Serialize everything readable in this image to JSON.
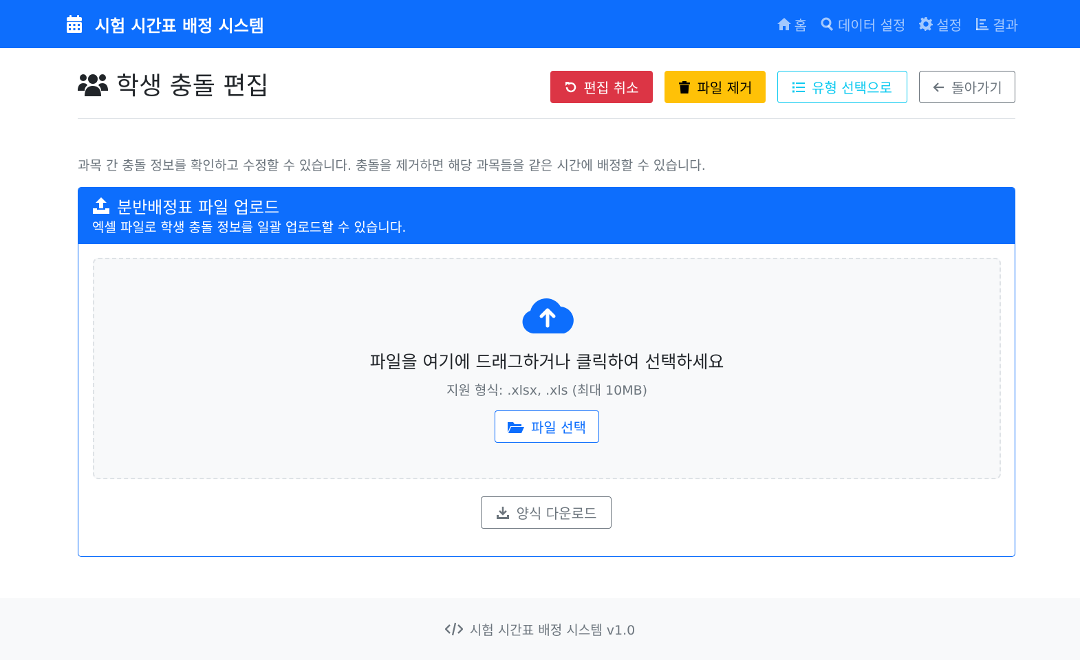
{
  "navbar": {
    "brand": "시험 시간표 배정 시스템",
    "brand_icon": "calendar-icon",
    "links": [
      {
        "label": "홈",
        "icon": "home-icon"
      },
      {
        "label": "데이터 설정",
        "icon": "search-icon"
      },
      {
        "label": "설정",
        "icon": "gear-icon"
      },
      {
        "label": "결과",
        "icon": "chart-icon"
      }
    ]
  },
  "header": {
    "title": "학생 충돌 편집",
    "title_icon": "users-icon",
    "buttons": {
      "cancel_edit": "편집 취소",
      "remove_file": "파일 제거",
      "to_type_select": "유형 선택으로",
      "back": "돌아가기"
    }
  },
  "description": "과목 간 충돌 정보를 확인하고 수정할 수 있습니다. 충돌을 제거하면 해당 과목들을 같은 시간에 배정할 수 있습니다.",
  "upload_card": {
    "title": "분반배정표 파일 업로드",
    "subtitle": "엑셀 파일로 학생 충돌 정보를 일괄 업로드할 수 있습니다.",
    "dropzone": {
      "title": "파일을 여기에 드래그하거나 클릭하여 선택하세요",
      "formats": "지원 형식: .xlsx, .xls (최대 10MB)",
      "select_button": "파일 선택"
    },
    "template_button": "양식 다운로드"
  },
  "footer": {
    "text": "시험 시간표 배정 시스템 v1.0"
  },
  "colors": {
    "primary": "#0d6efd",
    "danger": "#dc3545",
    "warning": "#ffc107",
    "info": "#0dcaf0",
    "secondary": "#6c757d"
  }
}
